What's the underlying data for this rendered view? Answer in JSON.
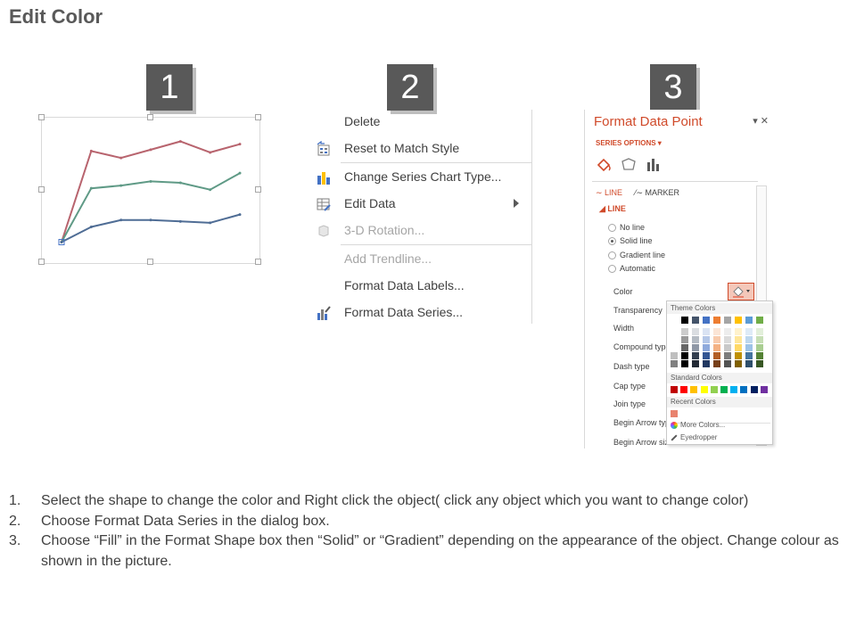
{
  "title": "Edit Color",
  "badges": [
    "1",
    "2",
    "3"
  ],
  "chart_data": {
    "type": "line",
    "x": [
      1,
      2,
      3,
      4,
      5,
      6,
      7
    ],
    "series": [
      {
        "values": [
          1.0,
          7.6,
          7.1,
          7.7,
          8.3,
          7.5,
          8.1
        ],
        "color": "#b8646e"
      },
      {
        "values": [
          1.0,
          4.9,
          5.1,
          5.4,
          5.3,
          4.8,
          6.0
        ],
        "color": "#5f9a86"
      },
      {
        "values": [
          1.0,
          2.1,
          2.6,
          2.6,
          2.5,
          2.4,
          3.0
        ],
        "color": "#4f6d95"
      }
    ],
    "ylim": [
      0,
      9.5
    ],
    "grid": false,
    "legend": "none"
  },
  "context_menu": {
    "items": [
      {
        "label": "Delete",
        "icon": "none",
        "disabled": false
      },
      {
        "label": "Reset to Match Style",
        "icon": "reset-style-icon",
        "disabled": false
      },
      {
        "label": "Change Series Chart Type...",
        "icon": "bar-chart-icon",
        "disabled": false
      },
      {
        "label": "Edit Data",
        "icon": "table-edit-icon",
        "disabled": false,
        "submenu": true
      },
      {
        "label": "3-D Rotation...",
        "icon": "cube-icon",
        "disabled": true
      },
      {
        "label": "Add Trendline...",
        "icon": "none",
        "disabled": true
      },
      {
        "label": "Format Data Labels...",
        "icon": "none",
        "disabled": false
      },
      {
        "label": "Format Data Series...",
        "icon": "format-series-icon",
        "disabled": false
      }
    ]
  },
  "format_pane": {
    "title": "Format Data Point",
    "series_options": "SERIES OPTIONS",
    "tab_line": "LINE",
    "tab_marker": "MARKER",
    "section_line": "LINE",
    "radio_options": [
      {
        "label": "No line",
        "selected": false
      },
      {
        "label": "Solid line",
        "selected": true
      },
      {
        "label": "Gradient line",
        "selected": false
      },
      {
        "label": "Automatic",
        "selected": false
      }
    ],
    "properties": [
      "Color",
      "Transparency",
      "Width",
      "Compound type",
      "Dash type",
      "Cap type",
      "Join type",
      "Begin Arrow type",
      "Begin Arrow size"
    ],
    "palette": {
      "theme_label": "Theme Colors",
      "standard_label": "Standard Colors",
      "recent_label": "Recent Colors",
      "more_colors": "More Colors...",
      "eyedropper": "Eyedropper",
      "theme_colors": [
        "#ffffff",
        "#000000",
        "#44546a",
        "#4472c4",
        "#ed7d31",
        "#a5a5a5",
        "#ffc000",
        "#5b9bd5",
        "#70ad47"
      ],
      "standard_colors": [
        "#c00000",
        "#ff0000",
        "#ffc000",
        "#ffff00",
        "#92d050",
        "#00b050",
        "#00b0f0",
        "#0070c0",
        "#002060",
        "#7030a0"
      ],
      "recent_colors": [
        "#e8826e"
      ]
    }
  },
  "steps": [
    {
      "num": "1.",
      "text": "Select the shape to change the color and Right click the object( click any object which you want to change color)"
    },
    {
      "num": "2.",
      "text": "Choose Format Data Series in the dialog box."
    },
    {
      "num": "3.",
      "text": "Choose “Fill” in the Format Shape box then “Solid” or “Gradient” depending on the appearance of the object. Change colour as shown in the picture."
    }
  ]
}
